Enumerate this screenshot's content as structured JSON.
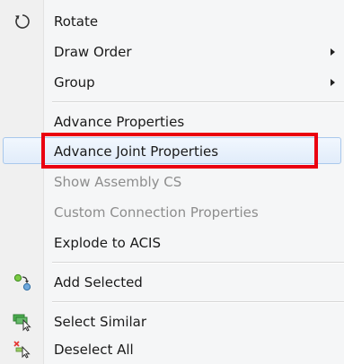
{
  "menu": {
    "items": [
      {
        "label": "Rotate",
        "icon": "rotate-icon",
        "submenu": false,
        "disabled": false
      },
      {
        "label": "Draw Order",
        "icon": "",
        "submenu": true,
        "disabled": false
      },
      {
        "label": "Group",
        "icon": "",
        "submenu": true,
        "disabled": false
      },
      {
        "label": "Advance Properties",
        "icon": "",
        "submenu": false,
        "disabled": false
      },
      {
        "label": "Advance Joint Properties",
        "icon": "",
        "submenu": false,
        "disabled": false,
        "hovered": true,
        "highlighted": true
      },
      {
        "label": "Show Assembly CS",
        "icon": "",
        "submenu": false,
        "disabled": true
      },
      {
        "label": "Custom Connection Properties",
        "icon": "",
        "submenu": false,
        "disabled": true
      },
      {
        "label": "Explode to ACIS",
        "icon": "",
        "submenu": false,
        "disabled": false
      },
      {
        "label": "Add Selected",
        "icon": "add-selected-icon",
        "submenu": false,
        "disabled": false
      },
      {
        "label": "Select Similar",
        "icon": "select-similar-icon",
        "submenu": false,
        "disabled": false
      },
      {
        "label": "Deselect All",
        "icon": "deselect-all-icon",
        "submenu": false,
        "disabled": false
      }
    ]
  },
  "colors": {
    "highlight_box": "#ea0010",
    "hover_border": "#a9c8ec",
    "disabled_text": "#8d8d8d"
  }
}
